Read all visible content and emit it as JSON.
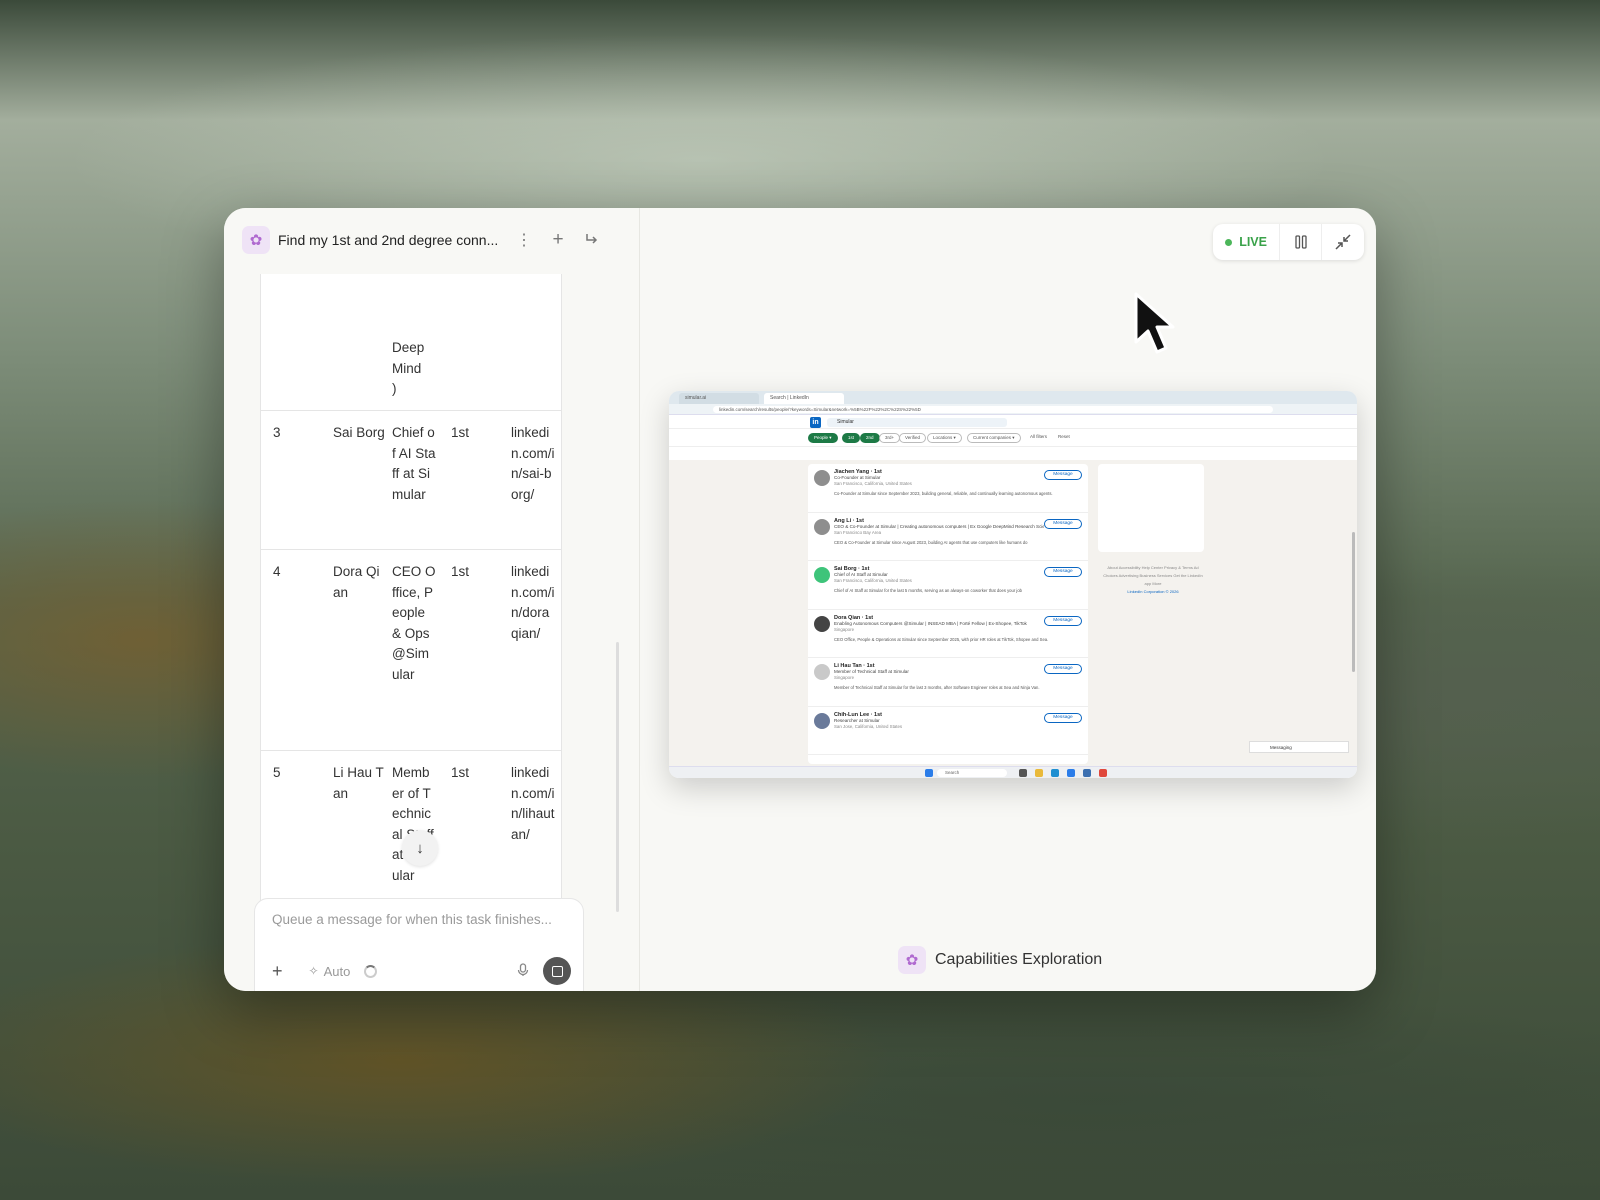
{
  "header": {
    "title": "Find my 1st and 2nd degree conn..."
  },
  "table": {
    "prev_tail": [
      "Deep",
      "Mind",
      ")"
    ],
    "rows": [
      {
        "num": "3",
        "name": "Sai Borg",
        "title": "Chief of AI Staff at Simular",
        "degree": "1st",
        "link": "linkedin.com/in/sai-borg/"
      },
      {
        "num": "4",
        "name": "Dora Qian",
        "title": "CEO Office, People & Ops @Simular",
        "degree": "1st",
        "link": "linkedin.com/in/doraqian/"
      },
      {
        "num": "5",
        "name": "Li Hau Tan",
        "title": "Member of Technical Staff at Simular",
        "degree": "1st",
        "link": "linkedin.com/in/lihautan/"
      }
    ]
  },
  "composer": {
    "placeholder": "Queue a message for when this task finishes...",
    "mode": "Auto"
  },
  "controls": {
    "live": "LIVE"
  },
  "screen": {
    "tabs": [
      "simular.ai",
      "Search | LinkedIn"
    ],
    "url": "linkedin.com/search/results/people/?keywords=Simular&network=%5B%22F%22%2C%22S%22%5D",
    "search": "Simular",
    "filters": [
      "People ▾",
      "1st",
      "2nd",
      "3rd+",
      "Verified",
      "Locations ▾",
      "Current companies ▾",
      "All filters",
      "Reset"
    ],
    "people": [
      {
        "name": "Jiachen Yang · 1st",
        "headline": "Co-Founder at Simular",
        "location": "San Francisco, California, United States",
        "summary": "Co-Founder at Simular since September 2023, building general, reliable, and continually learning autonomous agents."
      },
      {
        "name": "Ang Li · 1st",
        "headline": "CEO & Co-Founder at Simular | Creating autonomous computers | Ex Google DeepMind Research Scientist",
        "location": "San Francisco Bay Area",
        "summary": "CEO & Co-Founder at Simular since August 2023, building AI agents that use computers like humans do"
      },
      {
        "name": "Sai Borg · 1st",
        "headline": "Chief of AI Staff at Simular",
        "location": "San Francisco, California, United States",
        "summary": "Chief of AI Staff at Simular for the last 5 months, serving as an always-on coworker that does your job"
      },
      {
        "name": "Dora Qian · 1st",
        "headline": "Enabling Autonomous Computers @Simular | INSEAD MBA | Forté Fellow | Ex-Shopee, TikTok",
        "location": "Singapore",
        "summary": "CEO Office, People & Operations at Simular since September 2025, with prior HR roles at TikTok, Shopee and Sea."
      },
      {
        "name": "Li Hau Tan · 1st",
        "headline": "Member of Technical Staff at Simular",
        "location": "Singapore",
        "summary": "Member of Technical Staff at Simular for the last 3 months, after Software Engineer roles at Sea and Ninja Van."
      },
      {
        "name": "Chih-Lun Lee · 1st",
        "headline": "Researcher at Simular",
        "location": "San Jose, California, United States",
        "summary": ""
      }
    ],
    "message_label": "Message",
    "footer": "About  Accessibility  Help Center  Privacy & Terms  Ad Choices  Advertising  Business Services  Get the LinkedIn app  More",
    "copyright": "LinkedIn Corporation © 2026",
    "messaging": "Messaging",
    "taskbar_search": "Search"
  },
  "brand": {
    "label": "Capabilities Exploration"
  },
  "colors": {
    "live": "#3aa24a",
    "linkedin": "#0a66c2",
    "accent": "#b06ad0"
  }
}
